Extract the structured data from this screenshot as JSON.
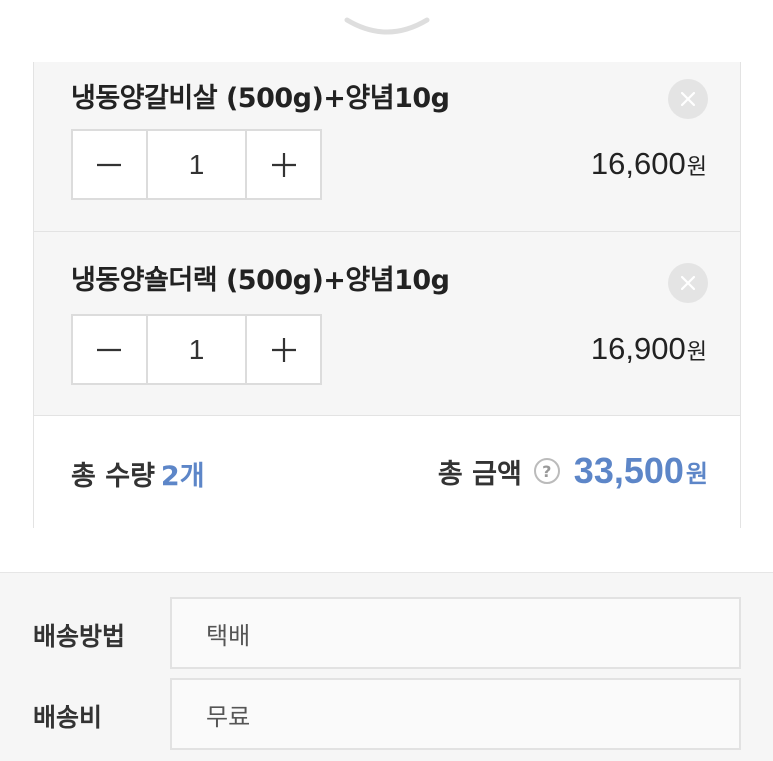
{
  "sheet": {
    "handle_icon": "chevron-down-icon"
  },
  "items": [
    {
      "name": "냉동양갈비살 (500g)+양념10g",
      "quantity": "1",
      "price": "16,600",
      "currency": "원",
      "remove_icon": "close-icon"
    },
    {
      "name": "냉동양숄더랙 (500g)+양념10g",
      "quantity": "1",
      "price": "16,900",
      "currency": "원",
      "remove_icon": "close-icon"
    }
  ],
  "stepper": {
    "minus_icon": "minus-icon",
    "plus_icon": "plus-icon"
  },
  "totals": {
    "quantity_label": "총 수량",
    "quantity_value": "2개",
    "amount_label": "총 금액",
    "help_symbol": "?",
    "amount_value": "33,500",
    "currency": "원"
  },
  "shipping": {
    "method_label": "배송방법",
    "method_value": "택배",
    "fee_label": "배송비",
    "fee_value": "무료"
  },
  "colors": {
    "accent": "#5d86c8",
    "panel_bg": "#f6f6f6",
    "border": "#e3e3e3"
  }
}
